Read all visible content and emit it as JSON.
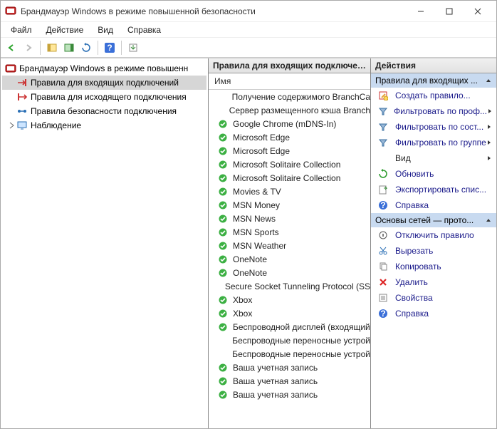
{
  "window": {
    "title": "Брандмауэр Windows в режиме повышенной безопасности"
  },
  "menu": {
    "file": "Файл",
    "action": "Действие",
    "view": "Вид",
    "help": "Справка"
  },
  "tree": {
    "root": "Брандмауэр Windows в режиме повышенн",
    "inbound": "Правила для входящих подключений",
    "outbound": "Правила для исходящего подключения",
    "connsec": "Правила безопасности подключения",
    "monitoring": "Наблюдение"
  },
  "center": {
    "header": "Правила для входящих подключений",
    "column": "Имя",
    "rules": [
      {
        "enabled": null,
        "name": "Получение содержимого BranchCa"
      },
      {
        "enabled": null,
        "name": "Сервер размещенного кэша Branch"
      },
      {
        "enabled": true,
        "name": "Google Chrome (mDNS-In)"
      },
      {
        "enabled": true,
        "name": "Microsoft Edge"
      },
      {
        "enabled": true,
        "name": "Microsoft Edge"
      },
      {
        "enabled": true,
        "name": "Microsoft Solitaire Collection"
      },
      {
        "enabled": true,
        "name": "Microsoft Solitaire Collection"
      },
      {
        "enabled": true,
        "name": "Movies & TV"
      },
      {
        "enabled": true,
        "name": "MSN Money"
      },
      {
        "enabled": true,
        "name": "MSN News"
      },
      {
        "enabled": true,
        "name": "MSN Sports"
      },
      {
        "enabled": true,
        "name": "MSN Weather"
      },
      {
        "enabled": true,
        "name": "OneNote"
      },
      {
        "enabled": true,
        "name": "OneNote"
      },
      {
        "enabled": null,
        "name": "Secure Socket Tunneling Protocol (SS"
      },
      {
        "enabled": true,
        "name": "Xbox"
      },
      {
        "enabled": true,
        "name": "Xbox"
      },
      {
        "enabled": true,
        "name": "Беспроводной дисплей (входящий"
      },
      {
        "enabled": null,
        "name": "Беспроводные переносные устрой"
      },
      {
        "enabled": null,
        "name": "Беспроводные переносные устрой"
      },
      {
        "enabled": true,
        "name": "Ваша учетная запись"
      },
      {
        "enabled": true,
        "name": "Ваша учетная запись"
      },
      {
        "enabled": true,
        "name": "Ваша учетная запись"
      }
    ]
  },
  "actions": {
    "header": "Действия",
    "section1": "Правила для входящих ...",
    "new_rule": "Создать правило...",
    "filter_profile": "Фильтровать по проф...",
    "filter_state": "Фильтровать по сост...",
    "filter_group": "Фильтровать по группе",
    "view": "Вид",
    "refresh": "Обновить",
    "export": "Экспортировать спис...",
    "help1": "Справка",
    "section2": "Основы сетей — прото...",
    "disable": "Отключить правило",
    "cut": "Вырезать",
    "copy": "Копировать",
    "delete": "Удалить",
    "properties": "Свойства",
    "help2": "Справка"
  }
}
